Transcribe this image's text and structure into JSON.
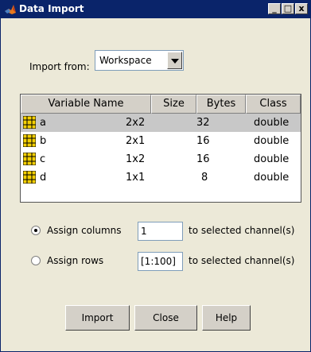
{
  "window": {
    "title": "Data Import",
    "minimize": "_",
    "maximize": "□",
    "close": "x"
  },
  "import_from": {
    "label": "Import from:",
    "value": "Workspace"
  },
  "table": {
    "headers": [
      "Variable Name",
      "Size",
      "Bytes",
      "Class"
    ],
    "rows": [
      {
        "name": "a",
        "size": "2x2",
        "bytes": "32",
        "class": "double",
        "selected": true
      },
      {
        "name": "b",
        "size": "2x1",
        "bytes": "16",
        "class": "double",
        "selected": false
      },
      {
        "name": "c",
        "size": "1x2",
        "bytes": "16",
        "class": "double",
        "selected": false
      },
      {
        "name": "d",
        "size": "1x1",
        "bytes": "8",
        "class": "double",
        "selected": false
      }
    ]
  },
  "assign_columns": {
    "label": "Assign columns",
    "value": "1",
    "suffix": "to selected channel(s)",
    "checked": true
  },
  "assign_rows": {
    "label": "Assign rows",
    "value": "[1:100]",
    "suffix": "to selected channel(s)",
    "checked": false
  },
  "buttons": {
    "import": "Import",
    "close": "Close",
    "help": "Help"
  }
}
